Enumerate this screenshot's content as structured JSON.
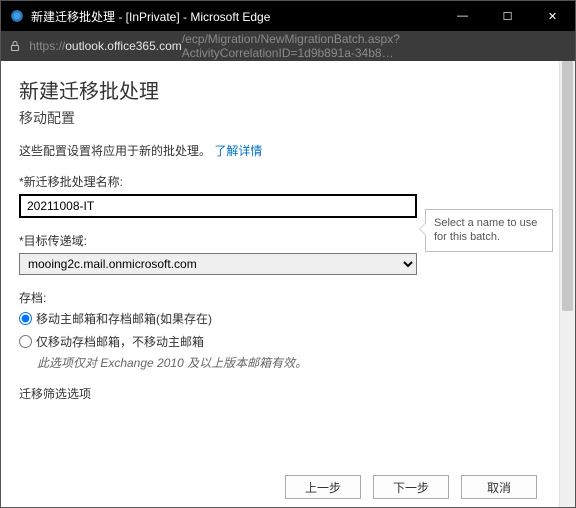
{
  "window": {
    "title": "新建迁移批处理 - [InPrivate] - Microsoft Edge",
    "url_host": "outlook.office365.com",
    "url_path": "/ecp/Migration/NewMigrationBatch.aspx?ActivityCorrelationID=1d9b891a-34b8…",
    "url_scheme": "https://"
  },
  "page": {
    "heading": "新建迁移批处理",
    "subtitle": "移动配置",
    "description": "这些配置设置将应用于新的批处理。",
    "learn_more": "了解详情"
  },
  "fields": {
    "name_label": "*新迁移批处理名称:",
    "name_value": "20211008-IT",
    "domain_label": "*目标传递域:",
    "domain_value": "mooing2c.mail.onmicrosoft.com"
  },
  "archive": {
    "section_label": "存档:",
    "opt1": "移动主邮箱和存档邮箱(如果存在)",
    "opt2": "仅移动存档邮箱，不移动主邮箱",
    "note": "此选项仅对 Exchange 2010 及以上版本邮箱有效。"
  },
  "filter": {
    "label": "迁移筛选选项"
  },
  "callout": {
    "text": "Select a name to use for this batch."
  },
  "buttons": {
    "back": "上一步",
    "next": "下一步",
    "cancel": "取消"
  },
  "winctrl": {
    "min": "—",
    "max": "☐",
    "close": "✕"
  }
}
